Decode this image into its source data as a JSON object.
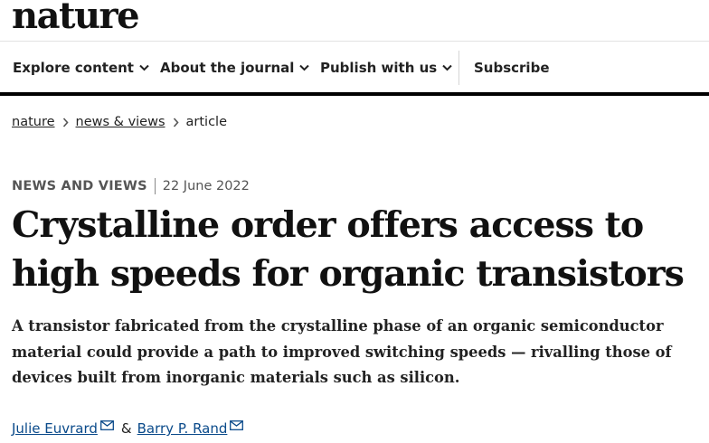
{
  "brand": {
    "name": "nature"
  },
  "nav": {
    "items": [
      {
        "label": "Explore content"
      },
      {
        "label": "About the journal"
      },
      {
        "label": "Publish with us"
      }
    ],
    "subscribe": "Subscribe"
  },
  "breadcrumb": [
    {
      "label": "nature"
    },
    {
      "label": "news & views"
    },
    {
      "label": "article"
    }
  ],
  "article": {
    "type": "NEWS AND VIEWS",
    "date": "22 June 2022",
    "title": "Crystalline order offers access to high speeds for organic transistors",
    "standfirst": "A transistor fabricated from the crystalline phase of an organic semiconductor material could provide a path to improved switching speeds — rivalling those of devices built from inorganic materials such as silicon.",
    "authors": [
      {
        "name": "Julie Euvrard"
      },
      {
        "name": "Barry P. Rand"
      }
    ],
    "author_separator": "&"
  },
  "icons": {
    "chevron": "chevron-down-icon",
    "crumb_separator": "chevron-right-icon",
    "email": "envelope-icon"
  },
  "colors": {
    "text": "#222222",
    "author_link": "#0a4a8a",
    "nav_rule": "#000000"
  }
}
